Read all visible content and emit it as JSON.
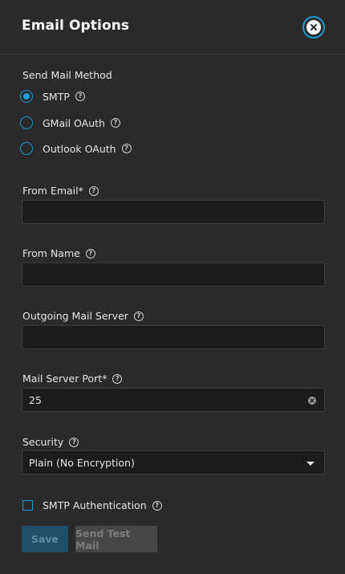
{
  "header": {
    "title": "Email Options",
    "close_icon": "close-icon"
  },
  "send_method": {
    "label": "Send Mail Method",
    "options": [
      {
        "label": "SMTP",
        "selected": true
      },
      {
        "label": "GMail OAuth",
        "selected": false
      },
      {
        "label": "Outlook OAuth",
        "selected": false
      }
    ]
  },
  "fields": {
    "from_email": {
      "label": "From Email",
      "required_mark": "*",
      "value": ""
    },
    "from_name": {
      "label": "From Name",
      "value": ""
    },
    "outgoing_server": {
      "label": "Outgoing Mail Server",
      "value": ""
    },
    "port": {
      "label": "Mail Server Port",
      "required_mark": "*",
      "value": "25"
    },
    "security": {
      "label": "Security",
      "value": "Plain (No Encryption)"
    }
  },
  "smtp_auth": {
    "label": "SMTP Authentication",
    "checked": false
  },
  "buttons": {
    "save": "Save",
    "send_test": "Send Test Mail"
  },
  "colors": {
    "accent": "#1a9bd7",
    "background": "#2a2a2a",
    "input_bg": "#1c1c1c"
  }
}
